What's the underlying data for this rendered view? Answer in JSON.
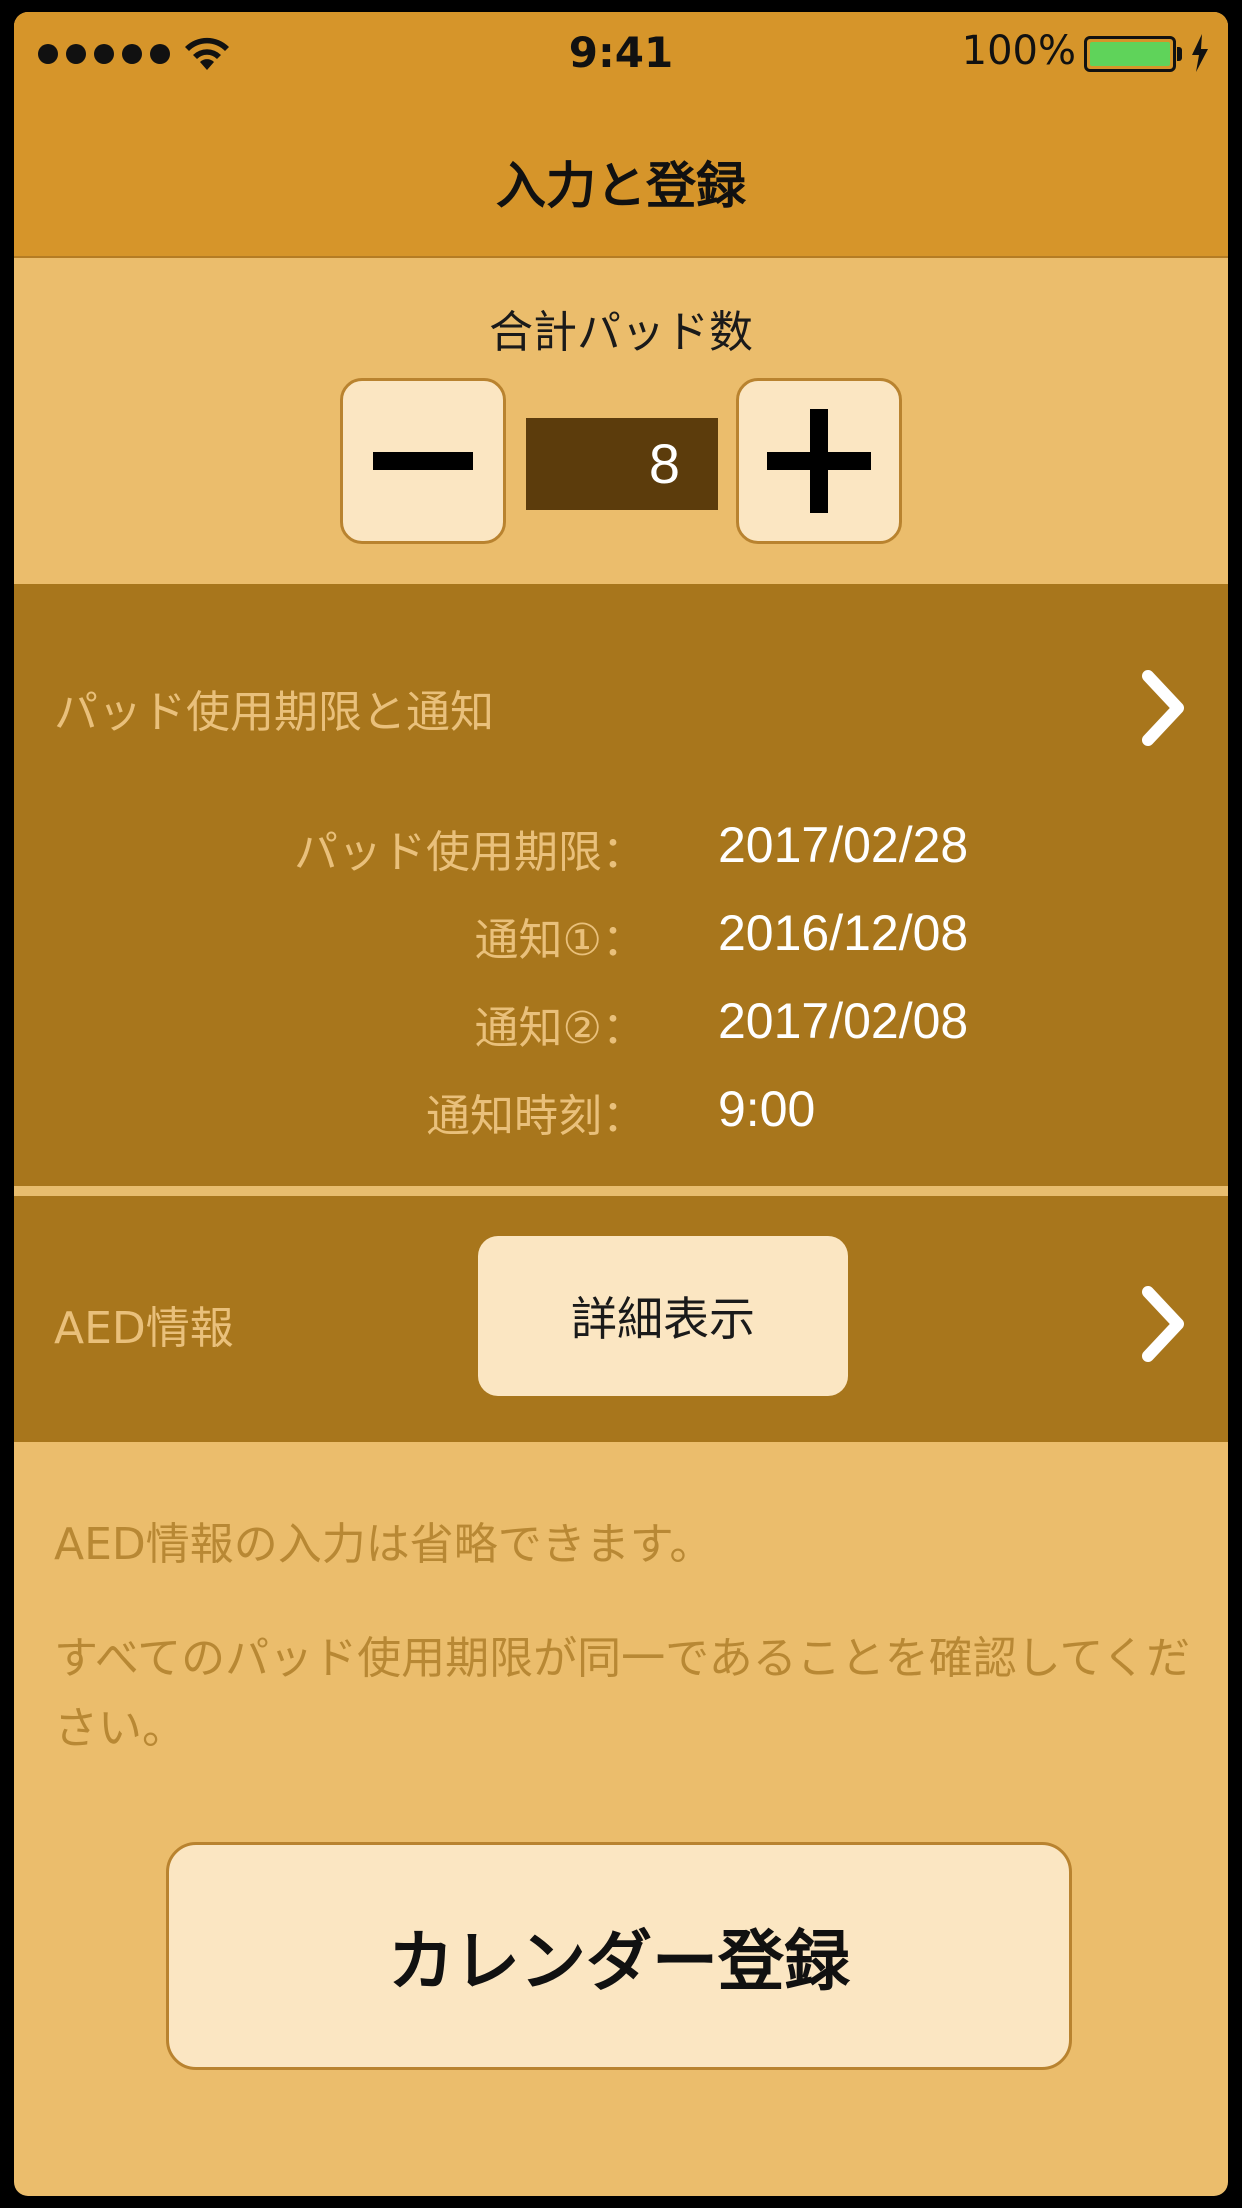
{
  "status_bar": {
    "time": "9:41",
    "battery_percent": "100%"
  },
  "nav": {
    "title": "入力と登録"
  },
  "pad_count": {
    "label": "合計パッド数",
    "value": "8"
  },
  "expiry": {
    "title": "パッド使用期限と通知",
    "rows": [
      {
        "label": "パッド使用期限：",
        "value": "2017/02/28"
      },
      {
        "label": "通知①：",
        "value": "2016/12/08"
      },
      {
        "label": "通知②：",
        "value": "2017/02/08"
      },
      {
        "label": "通知時刻：",
        "value": "9:00"
      }
    ]
  },
  "aed": {
    "title": "AED情報",
    "detail_button": "詳細表示"
  },
  "notes": [
    "AED情報の入力は省略できます。",
    "すべてのパッド使用期限が同一であることを確認してください。"
  ],
  "calendar_button": "カレンダー登録",
  "colors": {
    "header": "#d6952a",
    "panel": "#a8761c",
    "background": "#ebbd6c",
    "button": "#fbe6c2",
    "count_box": "#5c3c0c"
  }
}
